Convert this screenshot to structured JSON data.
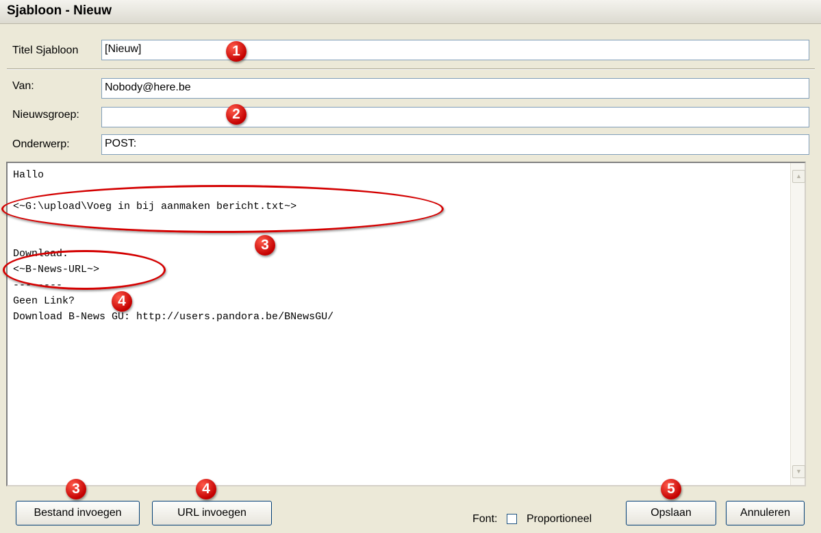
{
  "window": {
    "title": "Sjabloon - Nieuw"
  },
  "form": {
    "titel_label": "Titel Sjabloon",
    "titel_value": "[Nieuw]",
    "van_label": "Van:",
    "van_value": "Nobody@here.be",
    "nieuwsgroep_label": "Nieuwsgroep:",
    "nieuwsgroep_value": "",
    "onderwerp_label": "Onderwerp:",
    "onderwerp_value": "POST:"
  },
  "editor": {
    "body": "Hallo\n\n<~G:\\upload\\Voeg in bij aanmaken bericht.txt~>\n\n\nDownload:\n<~B-News-URL~>\n--------\nGeen Link?\nDownload B-News GU: http://users.pandora.be/BNewsGU/"
  },
  "buttons": {
    "bestand": "Bestand invoegen",
    "url": "URL invoegen",
    "opslaan": "Opslaan",
    "annuleren": "Annuleren"
  },
  "font": {
    "label": "Font:",
    "checkbox_label": "Proportioneel",
    "checked": false
  },
  "markers": [
    "1",
    "2",
    "3",
    "4",
    "3",
    "4",
    "5"
  ],
  "colors": {
    "marker": "#d40000",
    "field_border": "#7f9db9",
    "window_bg": "#ece9d8"
  }
}
